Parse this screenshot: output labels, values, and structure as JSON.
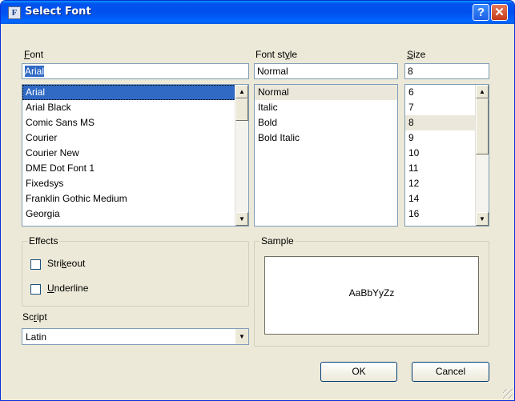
{
  "window": {
    "title": "Select Font",
    "help_glyph": "?",
    "close_glyph": "✕"
  },
  "font": {
    "label_accel": "F",
    "label_rest": "ont",
    "value": "Arial",
    "items": [
      "Arial",
      "Arial Black",
      "Comic Sans MS",
      "Courier",
      "Courier New",
      "DME Dot Font 1",
      "Fixedsys",
      "Franklin Gothic Medium",
      "Georgia"
    ],
    "selected": "Arial"
  },
  "style": {
    "label_pre": "Font st",
    "label_accel": "y",
    "label_post": "le",
    "value": "Normal",
    "items": [
      "Normal",
      "Italic",
      "Bold",
      "Bold Italic"
    ],
    "selected": "Normal"
  },
  "size": {
    "label_accel": "S",
    "label_rest": "ize",
    "value": "8",
    "items": [
      "6",
      "7",
      "8",
      "9",
      "10",
      "11",
      "12",
      "14",
      "16"
    ],
    "selected": "8"
  },
  "effects": {
    "title": "Effects",
    "strikeout_pre": "Stri",
    "strikeout_accel": "k",
    "strikeout_post": "eout",
    "underline_accel": "U",
    "underline_rest": "nderline"
  },
  "script": {
    "label_pre": "Sc",
    "label_accel": "r",
    "label_post": "ipt",
    "value": "Latin"
  },
  "sample": {
    "title": "Sample",
    "text": "AaBbYyZz"
  },
  "buttons": {
    "ok": "OK",
    "cancel": "Cancel"
  }
}
